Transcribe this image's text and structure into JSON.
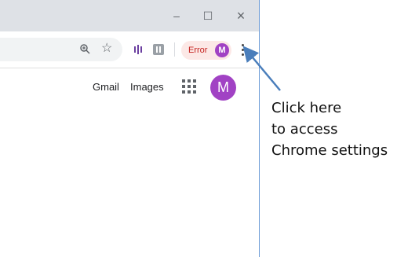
{
  "window_controls": {
    "minimize_glyph": "–",
    "maximize_glyph": "☐",
    "close_glyph": "×"
  },
  "toolbar": {
    "zoom_icon": "zoom-icon",
    "bookmark_icon": "star-icon",
    "extension_icons": [
      "extension-purple-icon",
      "extension-gray-icon"
    ],
    "profile_status_label": "Error",
    "profile_avatar_letter": "M",
    "menu_icon": "three-dots-vertical-icon"
  },
  "google_nav": {
    "gmail_label": "Gmail",
    "images_label": "Images",
    "apps_icon": "apps-grid-icon",
    "account_avatar_letter": "M"
  },
  "annotation": {
    "lines": [
      "Click here",
      "to access",
      "Chrome settings"
    ],
    "arrow_color": "#4a7ebb"
  },
  "colors": {
    "titlebar": "#dee1e6",
    "error_pill_bg": "#fce8e6",
    "error_text": "#c5221f",
    "avatar": "#a142c4"
  }
}
